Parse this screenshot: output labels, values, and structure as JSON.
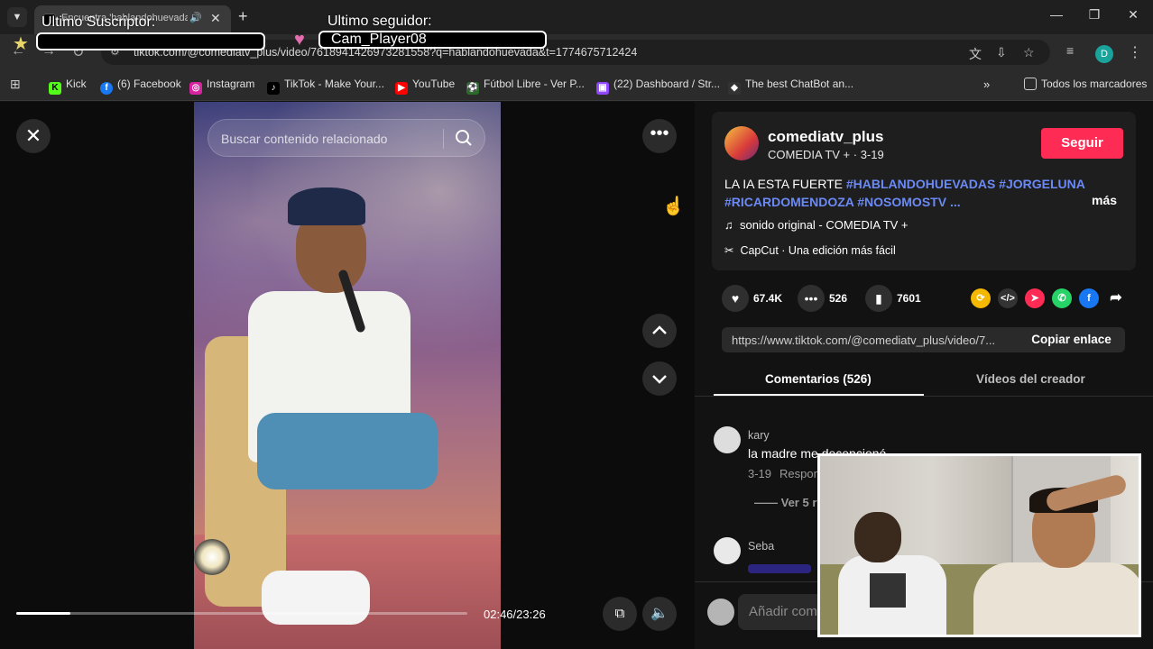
{
  "browser": {
    "tab_title": "Encuentra 'hablandohuevadas'",
    "url": "tiktok.com/@comediatv_plus/video/7618941426973281558?q=hablandohuevada&t=1774675712424",
    "profile_initial": "D",
    "bookmarks": [
      "Kick",
      "(6) Facebook",
      "Instagram",
      "TikTok - Make Your...",
      "YouTube",
      "Fútbol Libre - Ver P...",
      "(22) Dashboard / Str...",
      "The best ChatBot an..."
    ],
    "all_bookmarks_label": "Todos los marcadores"
  },
  "overlay": {
    "subscriber_label": "Ultimo Suscriptor:",
    "subscriber_value": "",
    "follower_label": "Ultimo seguidor:",
    "follower_value": "Cam_Player08"
  },
  "player": {
    "search_placeholder": "Buscar contenido relacionado",
    "time": "02:46/23:26",
    "progress": 0.12
  },
  "post": {
    "username": "comediatv_plus",
    "subline": "COMEDIA TV + · 3-19",
    "follow_label": "Seguir",
    "desc_prefix": "LA IA ESTA FUERTE ",
    "hashtags_line1": "#HABLANDOHUEVADAS #JORGELUNA",
    "hashtags_line2": "#RICARDOMENDOZA #NOSOMOSTV ...",
    "more_label": "más",
    "sound": "sonido original - COMEDIA TV +",
    "capcut": "CapCut · Una edición más fácil",
    "likes": "67.4K",
    "comments": "526",
    "saves": "7601",
    "link": "https://www.tiktok.com/@comediatv_plus/video/7...",
    "copy_label": "Copiar enlace"
  },
  "tabs": {
    "comments": "Comentarios (526)",
    "creator_videos": "Vídeos del creador"
  },
  "comments": [
    {
      "user": "kary",
      "text": "la madre me decepcionó",
      "date": "3-19",
      "reply": "Responder",
      "more": "Ver 5 r"
    },
    {
      "user": "Seba"
    }
  ],
  "comment_input_placeholder": "Añadir com",
  "colors": {
    "accent": "#fe2c55",
    "hashtag": "#6b8af6"
  }
}
